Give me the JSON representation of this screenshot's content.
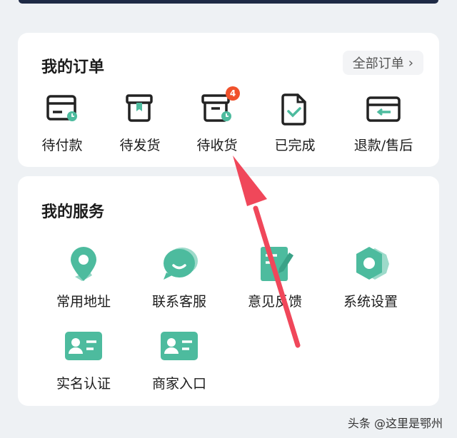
{
  "orders": {
    "title": "我的订单",
    "all_link": "全部订单",
    "items": [
      {
        "label": "待付款",
        "icon": "wallet-clock-icon"
      },
      {
        "label": "待发货",
        "icon": "box-icon"
      },
      {
        "label": "待收货",
        "icon": "box-clock-icon",
        "badge": "4"
      },
      {
        "label": "已完成",
        "icon": "document-check-icon"
      },
      {
        "label": "退款/售后",
        "icon": "refund-card-icon"
      }
    ]
  },
  "services": {
    "title": "我的服务",
    "items": [
      {
        "label": "常用地址",
        "icon": "location-pin-icon"
      },
      {
        "label": "联系客服",
        "icon": "chat-bubble-icon"
      },
      {
        "label": "意见反馈",
        "icon": "note-pen-icon"
      },
      {
        "label": "系统设置",
        "icon": "settings-hex-icon"
      },
      {
        "label": "实名认证",
        "icon": "id-card-icon"
      },
      {
        "label": "商家入口",
        "icon": "merchant-card-icon"
      }
    ]
  },
  "watermark": "头条 @这里是鄂州",
  "colors": {
    "accent": "#4dbb9e",
    "badge": "#f0512b",
    "arrow": "#f0475a"
  }
}
